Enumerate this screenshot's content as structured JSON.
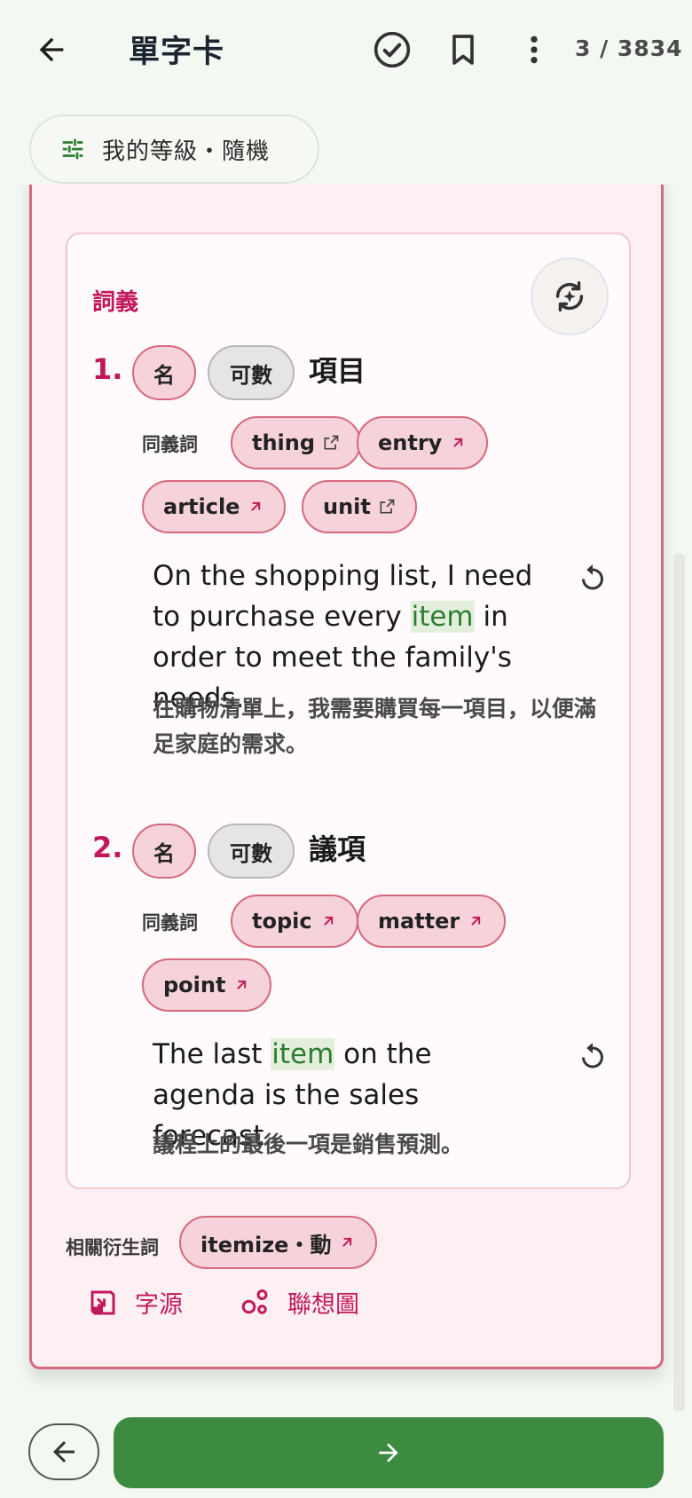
{
  "header": {
    "title": "單字卡",
    "counter": "3 / 3834",
    "filter_label": "我的等級・隨機"
  },
  "card": {
    "section_title": "詞義",
    "senses": [
      {
        "number": "1.",
        "pos": "名",
        "countability": "可數",
        "meaning": "項目",
        "synonyms_label": "同義詞",
        "synonyms": [
          "thing",
          "entry",
          "article",
          "unit"
        ],
        "example_before": "On the shopping list, I need to purchase every ",
        "example_highlight": "item",
        "example_after": " in order to meet the family's needs.",
        "translation": "在購物清單上，我需要購買每一項目，以便滿足家庭的需求。"
      },
      {
        "number": "2.",
        "pos": "名",
        "countability": "可數",
        "meaning": "議項",
        "synonyms_label": "同義詞",
        "synonyms": [
          "topic",
          "matter",
          "point"
        ],
        "example_before": "The last ",
        "example_highlight": "item",
        "example_after": " on the agenda is the sales forecast.",
        "translation": "議程上的最後一項是銷售預測。"
      }
    ],
    "derivatives_label": "相關衍生詞",
    "derivative": "itemize・動",
    "etymology_label": "字源",
    "mindmap_label": "聯想圖"
  },
  "colors": {
    "accent": "#c2185b",
    "primary_green": "#3d8b40",
    "highlight_bg": "#e3efdc",
    "chip_pink": "#f6d3da"
  }
}
